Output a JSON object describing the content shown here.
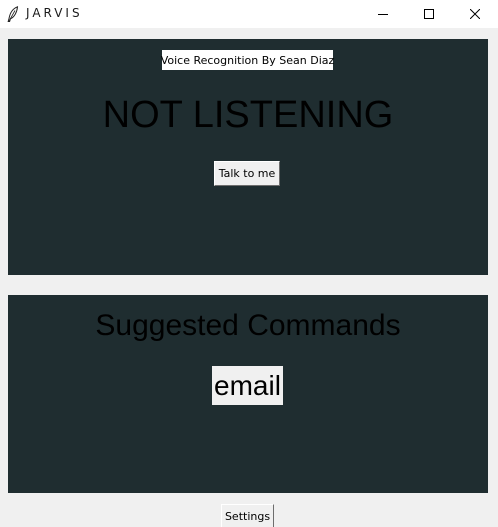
{
  "window": {
    "title": "JARVIS",
    "icon": "feather-icon",
    "controls": [
      "minimize-icon",
      "maximize-icon",
      "close-icon"
    ]
  },
  "main": {
    "credit": "Voice Recognition By Sean Diaz",
    "status": "NOT LISTENING",
    "talk_button": "Talk to me"
  },
  "suggestions": {
    "title": "Suggested Commands",
    "items": [
      "email"
    ]
  },
  "footer": {
    "settings_button": "Settings"
  },
  "colors": {
    "panel_background": "#1f2d30",
    "window_background": "#f0f0f0"
  }
}
